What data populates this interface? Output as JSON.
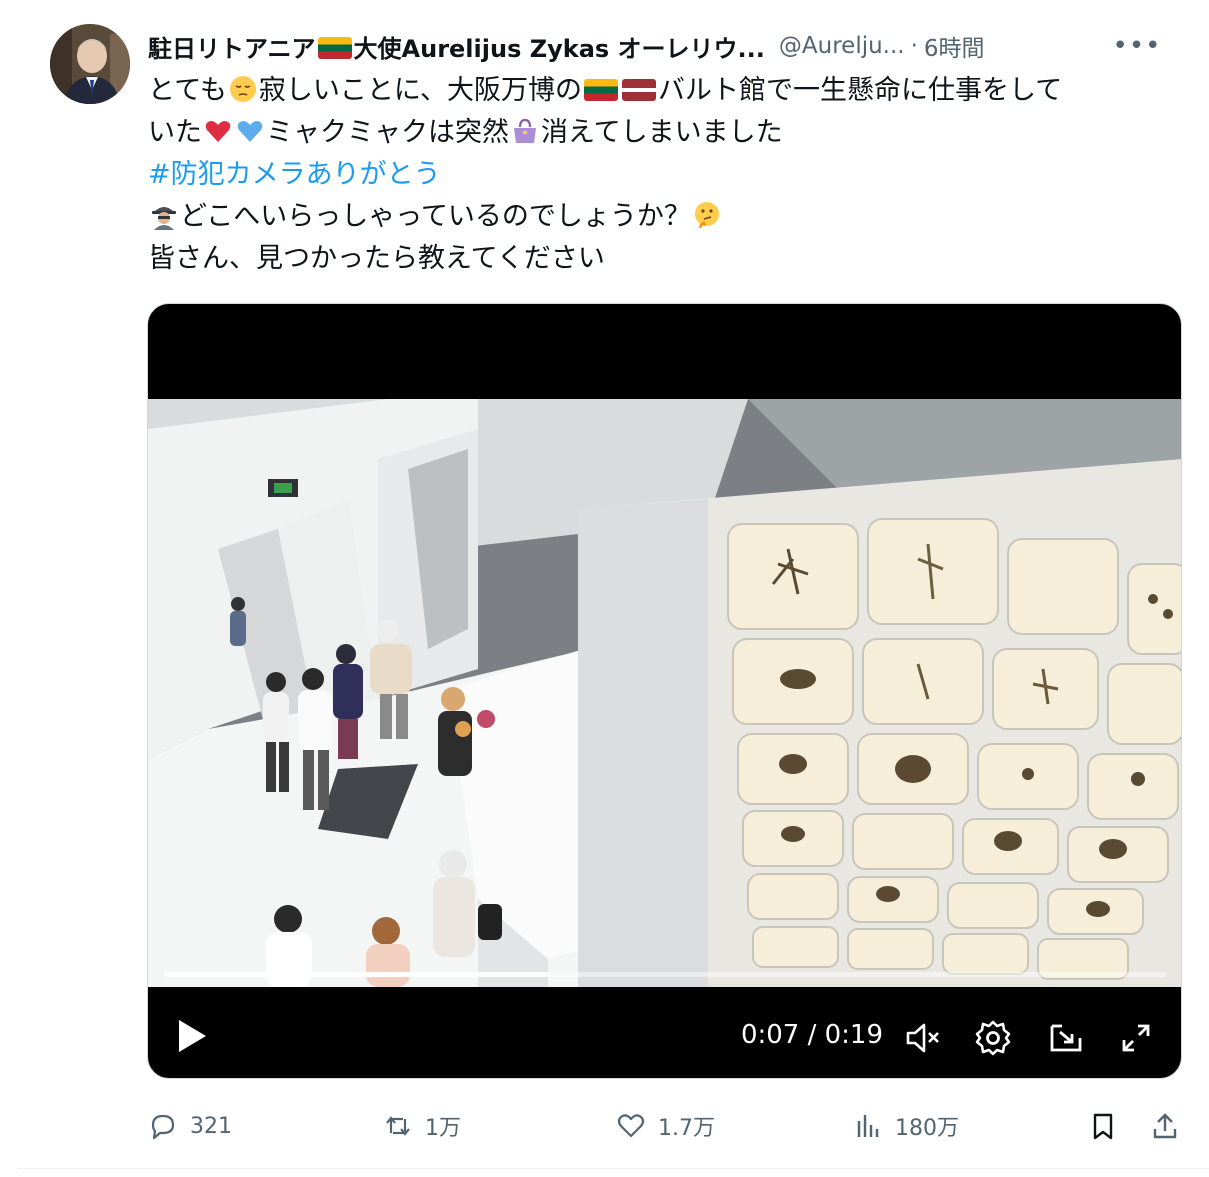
{
  "tweet": {
    "author": {
      "name_part1": "駐日リトアニア",
      "name_part2": "大使Aurelijus Zykas オーレリウ...",
      "handle": "@Aurelju...",
      "separator": "·",
      "time": "6時間",
      "more_label": "•••"
    },
    "text": {
      "l1_a": "とても",
      "l1_b": "寂しいことに、大阪万博の",
      "l1_c": "バルト館で一生懸命に仕事をして",
      "l2_a": "いた",
      "l2_b": "ミャクミャクは突然",
      "l2_c": "消えてしまいました",
      "hashtag": "#防犯カメラありがとう",
      "l4": "どこへいらっしゃっているのでしょうか？",
      "l5": "皆さん、見つかったら教えてください"
    },
    "emoji": {
      "pensive": "pensive-face-icon",
      "flag_lt": "lithuania-flag-icon",
      "flag_lv": "latvia-flag-icon",
      "red_heart": "red-heart-icon",
      "blue_heart": "blue-heart-icon",
      "purse": "purse-icon",
      "detective": "detective-icon",
      "thinking": "thinking-face-icon"
    },
    "video": {
      "time_readout": "0:07 / 0:19",
      "progress": 0.385,
      "play_icon": "play-icon",
      "mute_icon": "volume-muted-icon",
      "settings_icon": "gear-icon",
      "pip_icon": "picture-in-picture-icon",
      "fullscreen_icon": "fullscreen-icon"
    },
    "stats": {
      "replies": "321",
      "reposts": "1万",
      "likes": "1.7万",
      "views": "180万"
    },
    "colors": {
      "accent": "#1d9bf0",
      "muted": "#536471",
      "text": "#0f1419"
    }
  }
}
